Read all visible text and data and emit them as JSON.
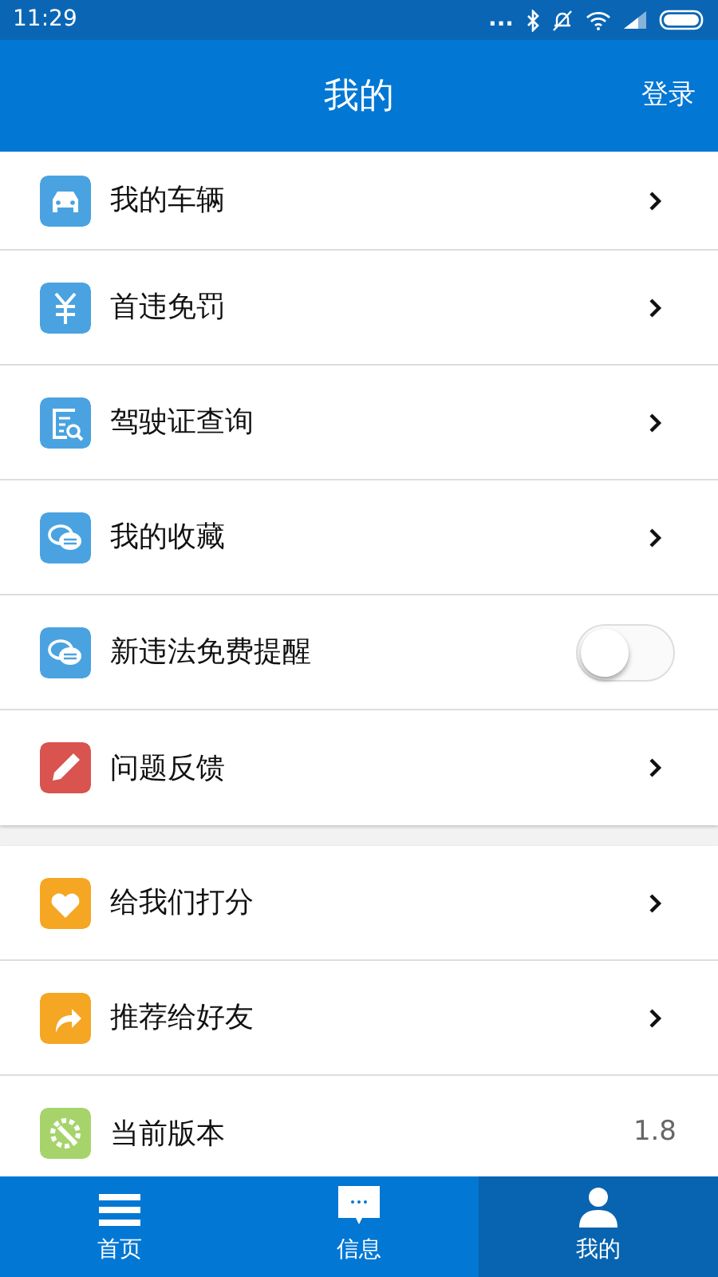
{
  "status_bar": {
    "time": "11:29",
    "dots": "..."
  },
  "header": {
    "title": "我的",
    "action": "登录"
  },
  "groups": [
    {
      "items": [
        {
          "kind": "link",
          "label": "我的车辆"
        },
        {
          "kind": "link",
          "label": "首违免罚"
        },
        {
          "kind": "link",
          "label": "驾驶证查询"
        },
        {
          "kind": "link",
          "label": "我的收藏"
        },
        {
          "kind": "toggle",
          "label": "新违法免费提醒",
          "on": false
        },
        {
          "kind": "link",
          "label": "问题反馈"
        }
      ]
    },
    {
      "items": [
        {
          "kind": "link",
          "label": "给我们打分"
        },
        {
          "kind": "link",
          "label": "推荐给好友"
        },
        {
          "kind": "value",
          "label": "当前版本",
          "value": "1.8"
        }
      ]
    }
  ],
  "tab_bar": [
    {
      "label": "首页",
      "selected": false
    },
    {
      "label": "信息",
      "selected": false
    },
    {
      "label": "我的",
      "selected": true
    }
  ]
}
